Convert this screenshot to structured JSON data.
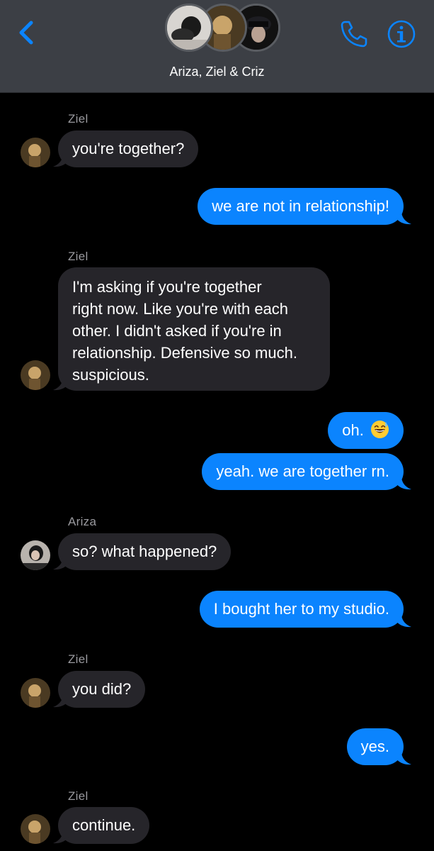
{
  "header": {
    "title": "Ariza, Ziel & Criz",
    "colors": {
      "accent": "#0b84fe",
      "header_bg": "#3c3f45"
    }
  },
  "messages": [
    {
      "sender": "Ziel",
      "text": "you're together?",
      "direction": "incoming"
    },
    {
      "text": "we are not in relationship!",
      "direction": "outgoing"
    },
    {
      "sender": "Ziel",
      "lines": [
        "I'm asking if you're together",
        "right now. Like you're with each",
        "other. I didn't asked if you're in",
        "relationship. Defensive so much.",
        "suspicious."
      ],
      "direction": "incoming"
    },
    {
      "text": "oh.",
      "emoji": "grinning-sweat-emoji",
      "direction": "outgoing"
    },
    {
      "text": "yeah. we are together rn.",
      "direction": "outgoing"
    },
    {
      "sender": "Ariza",
      "text": "so? what happened?",
      "direction": "incoming"
    },
    {
      "text": "I bought her to my studio.",
      "direction": "outgoing"
    },
    {
      "sender": "Ziel",
      "text": "you did?",
      "direction": "incoming"
    },
    {
      "text": "yes.",
      "direction": "outgoing"
    },
    {
      "sender": "Ziel",
      "text": "continue.",
      "direction": "incoming"
    }
  ]
}
